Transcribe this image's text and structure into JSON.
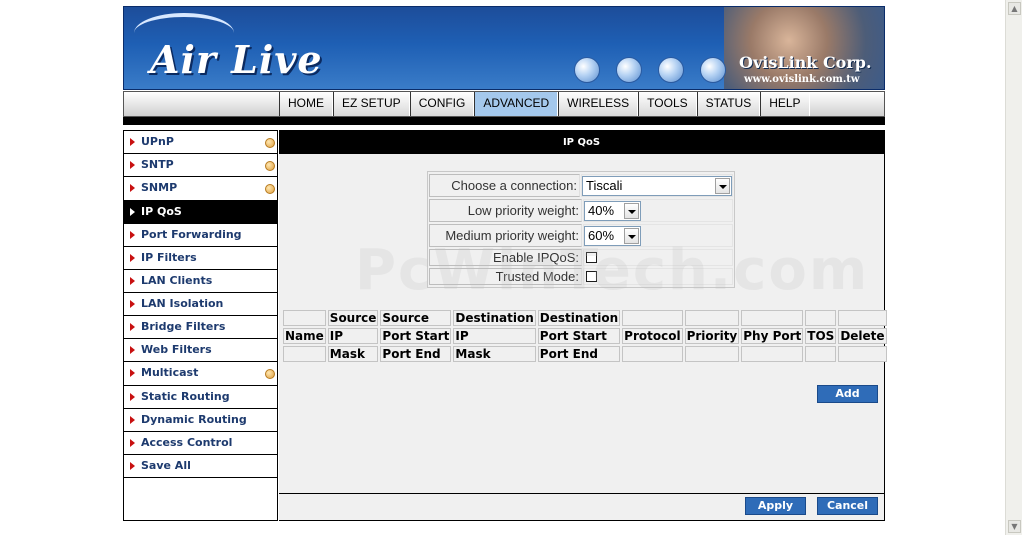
{
  "banner": {
    "logo": "Air Live",
    "corp": "OvisLink Corp.",
    "url": "www.ovislink.com.tw"
  },
  "nav": {
    "tabs": [
      "HOME",
      "EZ SETUP",
      "CONFIG",
      "ADVANCED",
      "WIRELESS",
      "TOOLS",
      "STATUS",
      "HELP"
    ],
    "active": "ADVANCED"
  },
  "sidebar": {
    "items": [
      {
        "label": "UPnP"
      },
      {
        "label": "SNTP"
      },
      {
        "label": "SNMP"
      },
      {
        "label": "IP QoS"
      },
      {
        "label": "Port Forwarding"
      },
      {
        "label": "IP Filters"
      },
      {
        "label": "LAN Clients"
      },
      {
        "label": "LAN Isolation"
      },
      {
        "label": "Bridge Filters"
      },
      {
        "label": "Web Filters"
      },
      {
        "label": "Multicast"
      },
      {
        "label": "Static Routing"
      },
      {
        "label": "Dynamic Routing"
      },
      {
        "label": "Access Control"
      },
      {
        "label": "Save All"
      }
    ],
    "active": "IP QoS"
  },
  "main": {
    "title": "IP QoS",
    "connection_label": "Choose a connection:",
    "connection_value": "Tiscali",
    "low_label": "Low priority weight:",
    "low_value": "40%",
    "medium_label": "Medium priority weight:",
    "medium_value": "60%",
    "enable_label": "Enable IPQoS:",
    "enable_checked": false,
    "trusted_label": "Trusted Mode:",
    "trusted_checked": false,
    "table": {
      "row1": [
        "",
        "Source",
        "Source",
        "Destination",
        "Destination",
        "",
        "",
        "",
        "",
        ""
      ],
      "row2": [
        "Name",
        "IP",
        "Port Start",
        "IP",
        "Port Start",
        "Protocol",
        "Priority",
        "Phy Port",
        "TOS",
        "Delete"
      ],
      "row3": [
        "",
        "Mask",
        "Port End",
        "Mask",
        "Port End",
        "",
        "",
        "",
        "",
        ""
      ]
    },
    "add_label": "Add",
    "apply_label": "Apply",
    "cancel_label": "Cancel"
  },
  "watermark": "PcWinTech.com"
}
